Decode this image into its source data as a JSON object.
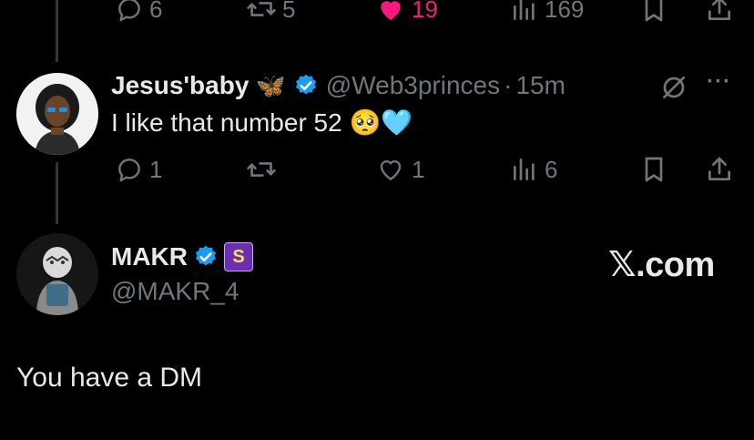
{
  "top_tweet_actions": {
    "reply_count": "6",
    "retweet_count": "5",
    "like_count": "19",
    "view_count": "169"
  },
  "reply_tweet": {
    "display_name": "Jesus'baby",
    "name_emoji": "🦋",
    "handle": "@Web3princes",
    "separator": "·",
    "time": "15m",
    "more_menu": "···",
    "text": "I like that number 52",
    "text_emoji": "🥺🩵",
    "actions": {
      "reply_count": "1",
      "retweet_count": "",
      "like_count": "1",
      "view_count": "6"
    }
  },
  "main_tweet": {
    "display_name": "MAKR",
    "handle": "@MAKR_4",
    "brand_badge_letter": "S",
    "watermark": "𝕏.com",
    "text": "You have a DM"
  },
  "colors": {
    "background": "#000000",
    "text_primary": "#e7e9ea",
    "text_secondary": "#71767b",
    "like_pink": "#f91880",
    "verified_blue": "#1d9bf0",
    "badge_purple": "#6b2fb3"
  }
}
